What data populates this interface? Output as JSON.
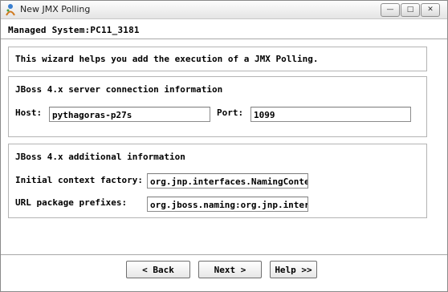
{
  "window": {
    "title": "New JMX Polling"
  },
  "titlebar_buttons": {
    "minimize": "—",
    "maximize": "□",
    "close": "✕"
  },
  "managed_system": "Managed System:PC11_3181",
  "intro": "This wizard helps you add the execution of a JMX Polling.",
  "connection": {
    "heading": "JBoss 4.x server connection information",
    "host_label": "Host:",
    "host_value": "pythagoras-p27s",
    "port_label": "Port:",
    "port_value": "1099"
  },
  "additional": {
    "heading": "JBoss 4.x additional information",
    "context_label": "Initial context factory:",
    "context_value": "org.jnp.interfaces.NamingContextFactory",
    "url_label": "URL package prefixes:",
    "url_value": "org.jboss.naming:org.jnp.interfaces"
  },
  "buttons": {
    "back": "< Back",
    "next": "Next >",
    "help": "Help >>"
  }
}
